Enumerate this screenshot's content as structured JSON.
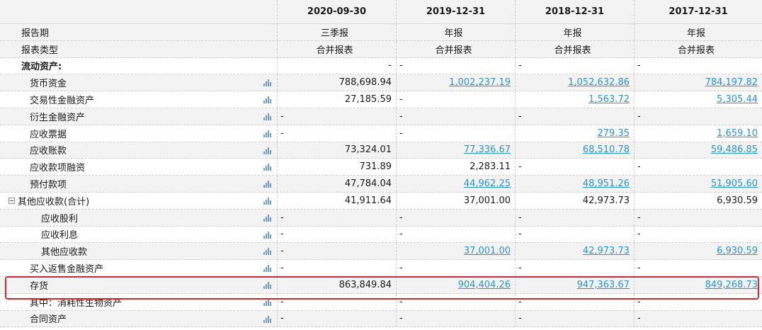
{
  "columns": [
    "2020-09-30",
    "2019-12-31",
    "2018-12-31",
    "2017-12-31"
  ],
  "meta_rows": [
    {
      "label": "报告期",
      "values": [
        "三季报",
        "年报",
        "年报",
        "年报"
      ]
    },
    {
      "label": "报表类型",
      "values": [
        "合并报表",
        "合并报表",
        "合并报表",
        "合并报表"
      ]
    }
  ],
  "section": {
    "label": "流动资产:",
    "values": [
      "-",
      "-",
      "-",
      "-"
    ]
  },
  "rows": [
    {
      "label": "货币资金",
      "values": [
        "788,698.94",
        "1,002,237.19",
        "1,052,632.86",
        "784,197.82"
      ],
      "links": [
        false,
        true,
        true,
        true
      ]
    },
    {
      "label": "交易性金融资产",
      "values": [
        "27,185.59",
        "-",
        "1,563.72",
        "5,305.44"
      ],
      "links": [
        false,
        false,
        true,
        true
      ]
    },
    {
      "label": "衍生金融资产",
      "values": [
        "-",
        "-",
        "-",
        "-"
      ],
      "links": [
        false,
        false,
        false,
        false
      ]
    },
    {
      "label": "应收票据",
      "values": [
        "-",
        "-",
        "279.35",
        "1,659.10"
      ],
      "links": [
        false,
        false,
        true,
        true
      ]
    },
    {
      "label": "应收账款",
      "values": [
        "73,324.01",
        "77,336.67",
        "68,510.78",
        "59,486.85"
      ],
      "links": [
        false,
        true,
        true,
        true
      ]
    },
    {
      "label": "应收款项融资",
      "values": [
        "731.89",
        "2,283.11",
        "-",
        "-"
      ],
      "links": [
        false,
        false,
        false,
        false
      ]
    },
    {
      "label": "预付款项",
      "values": [
        "47,784.04",
        "44,962.25",
        "48,951.26",
        "51,905.60"
      ],
      "links": [
        false,
        true,
        true,
        true
      ]
    },
    {
      "label": "其他应收款(合计)",
      "values": [
        "41,911.64",
        "37,001.00",
        "42,973.73",
        "6,930.59"
      ],
      "links": [
        false,
        false,
        false,
        false
      ]
    },
    {
      "label": "应收股利",
      "values": [
        "-",
        "-",
        "-",
        "-"
      ],
      "links": [
        false,
        false,
        false,
        false
      ]
    },
    {
      "label": "应收利息",
      "values": [
        "-",
        "-",
        "-",
        "-"
      ],
      "links": [
        false,
        false,
        false,
        false
      ]
    },
    {
      "label": "其他应收款",
      "values": [
        "-",
        "37,001.00",
        "42,973.73",
        "6,930.59"
      ],
      "links": [
        false,
        true,
        true,
        true
      ]
    },
    {
      "label": "买入返售金融资产",
      "values": [
        "-",
        "-",
        "-",
        "-"
      ],
      "links": [
        false,
        false,
        false,
        false
      ]
    },
    {
      "label": "存货",
      "values": [
        "863,849.84",
        "904,404.26",
        "947,363.67",
        "849,268.73"
      ],
      "links": [
        false,
        true,
        true,
        true
      ]
    },
    {
      "label": "其中：消耗性生物资产",
      "values": [
        "-",
        "-",
        "-",
        "-"
      ],
      "links": [
        false,
        false,
        false,
        false
      ]
    },
    {
      "label": "合同资产",
      "values": [
        "-",
        "-",
        "-",
        "-"
      ],
      "links": [
        false,
        false,
        false,
        false
      ]
    }
  ],
  "icons": {
    "chart": "bar-chart-icon",
    "collapse": "collapse-minus-icon"
  },
  "colors": {
    "link": "#2196d6",
    "highlight": "#d9262a",
    "chart_icon": "#6a9fd8",
    "alt_row_bg": "#f3f3f3"
  }
}
